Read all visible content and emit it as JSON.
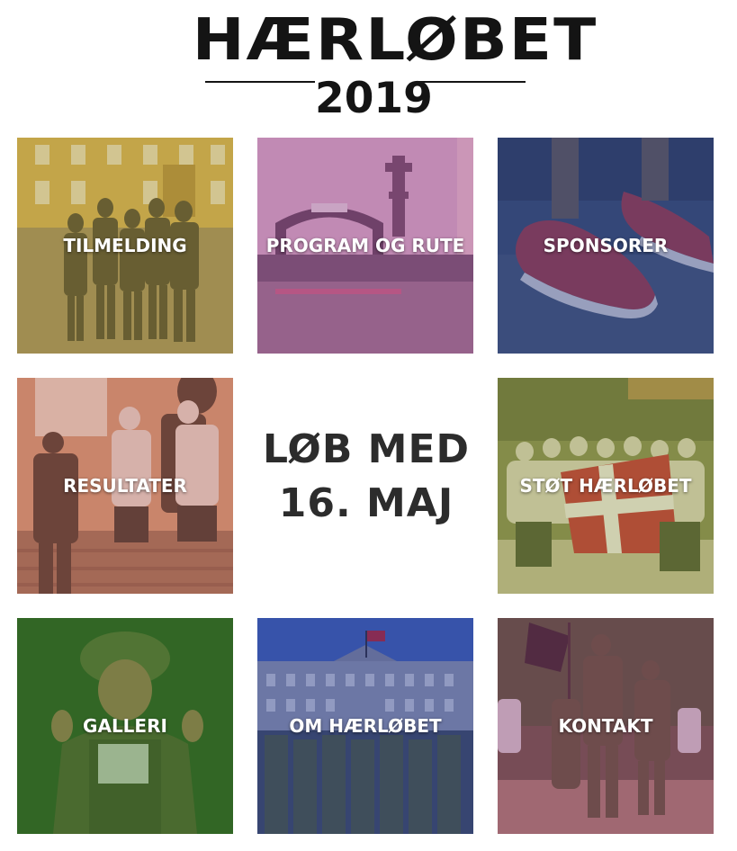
{
  "header": {
    "title": "HÆRLØBET",
    "year": "2019"
  },
  "tiles": [
    {
      "label": "TILMELDING",
      "tint": "#a7923a"
    },
    {
      "label": "PROGRAM OG RUTE",
      "tint": "#a2518c"
    },
    {
      "label": "SPONSORER",
      "tint": "#2d3f7a"
    },
    {
      "label": "RESULTATER",
      "tint": "#b26a54"
    },
    {
      "label": "STØT HÆRLØBET",
      "tint": "#8c8f42"
    },
    {
      "label": "GALLERI",
      "tint": "#2f6b1f"
    },
    {
      "label": "OM HÆRLØBET",
      "tint": "#2e3f8a"
    },
    {
      "label": "KONTAKT",
      "tint": "#8a3a66"
    }
  ],
  "center": {
    "line1": "LØB MED",
    "line2": "16. MAJ"
  }
}
